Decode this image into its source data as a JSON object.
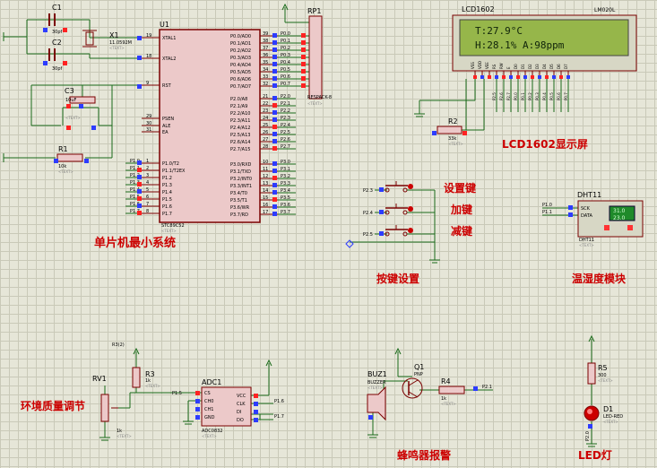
{
  "components": {
    "c1": {
      "ref": "C1",
      "value": "30pf",
      "text": "<TEXT>"
    },
    "c2": {
      "ref": "C2",
      "value": "30pf",
      "text": "<TEXT>"
    },
    "x1": {
      "ref": "X1",
      "value": "11.0592M",
      "text": "<TEXT>"
    },
    "c3": {
      "ref": "C3",
      "value": "10uF",
      "text": "<TEXT>"
    },
    "r1": {
      "ref": "R1",
      "value": "10k",
      "text": "<TEXT>"
    },
    "u1": {
      "ref": "U1",
      "part": "STC89C52",
      "text": "<TEXT>",
      "left_pins": [
        {
          "num": "19",
          "name": "XTAL1"
        },
        {
          "num": "18",
          "name": "XTAL2"
        },
        {
          "num": "9",
          "name": "RST"
        },
        {
          "num": "29",
          "name": "PSEN"
        },
        {
          "num": "30",
          "name": "ALE"
        },
        {
          "num": "31",
          "name": "EA"
        },
        {
          "num": "1",
          "name": "P1.0/T2"
        },
        {
          "num": "2",
          "name": "P1.1/T2EX"
        },
        {
          "num": "3",
          "name": "P1.2"
        },
        {
          "num": "4",
          "name": "P1.3"
        },
        {
          "num": "5",
          "name": "P1.4"
        },
        {
          "num": "6",
          "name": "P1.5"
        },
        {
          "num": "7",
          "name": "P1.6"
        },
        {
          "num": "8",
          "name": "P1.7"
        }
      ],
      "right_pins": [
        {
          "num": "39",
          "name": "P0.0/AD0"
        },
        {
          "num": "38",
          "name": "P0.1/AD1"
        },
        {
          "num": "37",
          "name": "P0.2/AD2"
        },
        {
          "num": "36",
          "name": "P0.3/AD3"
        },
        {
          "num": "35",
          "name": "P0.4/AD4"
        },
        {
          "num": "34",
          "name": "P0.5/AD5"
        },
        {
          "num": "33",
          "name": "P0.6/AD6"
        },
        {
          "num": "32",
          "name": "P0.7/AD7"
        },
        {
          "num": "21",
          "name": "P2.0/A8"
        },
        {
          "num": "22",
          "name": "P2.1/A9"
        },
        {
          "num": "23",
          "name": "P2.2/A10"
        },
        {
          "num": "24",
          "name": "P2.3/A11"
        },
        {
          "num": "25",
          "name": "P2.4/A12"
        },
        {
          "num": "26",
          "name": "P2.5/A13"
        },
        {
          "num": "27",
          "name": "P2.6/A14"
        },
        {
          "num": "28",
          "name": "P2.7/A15"
        },
        {
          "num": "10",
          "name": "P3.0/RXD"
        },
        {
          "num": "11",
          "name": "P3.1/TXD"
        },
        {
          "num": "12",
          "name": "P3.2/INT0"
        },
        {
          "num": "13",
          "name": "P3.3/INT1"
        },
        {
          "num": "14",
          "name": "P3.4/T0"
        },
        {
          "num": "15",
          "name": "P3.5/T1"
        },
        {
          "num": "16",
          "name": "P3.6/WR"
        },
        {
          "num": "17",
          "name": "P3.7/RD"
        }
      ],
      "left_nets": [
        "P1.0",
        "P1.1",
        "P1.2",
        "P1.3",
        "P1.4",
        "P1.5",
        "P1.6",
        "P1.7"
      ],
      "right_nets": [
        "P0.0",
        "P0.1",
        "P0.2",
        "P0.3",
        "P0.4",
        "P0.5",
        "P0.6",
        "P0.7",
        "P2.0",
        "P2.1",
        "P2.2",
        "P2.3",
        "P2.4",
        "P2.5",
        "P2.6",
        "P2.7",
        "P3.0",
        "P3.1",
        "P3.2",
        "P3.3",
        "P3.4",
        "P3.5",
        "P3.6",
        "P3.7"
      ]
    },
    "rp1": {
      "ref": "RP1",
      "part": "RESPACK-8",
      "text": "<TEXT>"
    },
    "lcd": {
      "ref": "LCD1602",
      "part": "LM020L",
      "line1": "T:27.9°C",
      "line2": "H:28.1% A:98ppm",
      "pins": [
        "VSS",
        "VDD",
        "VEE",
        "RS",
        "RW",
        "E",
        "D0",
        "D1",
        "D2",
        "D3",
        "D4",
        "D5",
        "D6",
        "D7"
      ],
      "nets": [
        "P2.5",
        "P2.6",
        "P2.7",
        "P0.0",
        "P0.1",
        "P0.2",
        "P0.3",
        "P0.4",
        "P0.5",
        "P0.6",
        "P0.7"
      ]
    },
    "r2": {
      "ref": "R2",
      "value": "33k",
      "text": "<TEXT>"
    },
    "dht11": {
      "ref": "DHT11",
      "text": "<TEXT>",
      "pins": [
        "SCK",
        "DATA"
      ],
      "nets": [
        "P1.0",
        "P1.1"
      ],
      "readout1": "31.0",
      "readout2": "23.0"
    },
    "buttons": {
      "nets": [
        "P2.3",
        "P2.4",
        "P2.5"
      ]
    },
    "rv1": {
      "ref": "RV1",
      "value": "1k",
      "text": "<TEXT>"
    },
    "r3": {
      "ref": "R3",
      "value": "1k",
      "text": "<TEXT>",
      "net": "R3(2)"
    },
    "adc1": {
      "ref": "ADC1",
      "part": "ADC0832",
      "text": "<TEXT>",
      "left_pins": [
        "CS",
        "CH0",
        "CH1",
        "GND"
      ],
      "right_pins": [
        "VCC",
        "CLK",
        "DI",
        "DO"
      ],
      "nets_left": [
        "P1.5"
      ],
      "nets_right": [
        "P1.6",
        "P1.7"
      ]
    },
    "buz1": {
      "ref": "BUZ1",
      "part": "BUZZER",
      "text": "<TEXT>"
    },
    "q1": {
      "ref": "Q1",
      "part": "PNP"
    },
    "r4": {
      "ref": "R4",
      "value": "1k",
      "text": "<TEXT>",
      "net": "P2.1"
    },
    "r5": {
      "ref": "R5",
      "value": "300",
      "text": "<TEXT>"
    },
    "d1": {
      "ref": "D1",
      "part": "LED-RED",
      "text": "<TEXT>",
      "net": "P2.0"
    }
  },
  "sections": {
    "mcu": "单片机最小系统",
    "lcd": "LCD1602显示屏",
    "buttons": "按键设置",
    "set_key": "设置键",
    "plus_key": "加键",
    "minus_key": "减键",
    "dht": "温湿度模块",
    "air": "环境质量调节",
    "buzzer": "蜂鸣器报警",
    "led": "LED灯"
  },
  "colors": {
    "wire": "#1a6b1a",
    "component": "#7a0000",
    "section_label": "#cc0000",
    "pin_blue": "#2d3cff",
    "pin_red": "#ff2222",
    "lcd_bg": "#96b64a",
    "chip_fill": "#ecc9c9"
  }
}
